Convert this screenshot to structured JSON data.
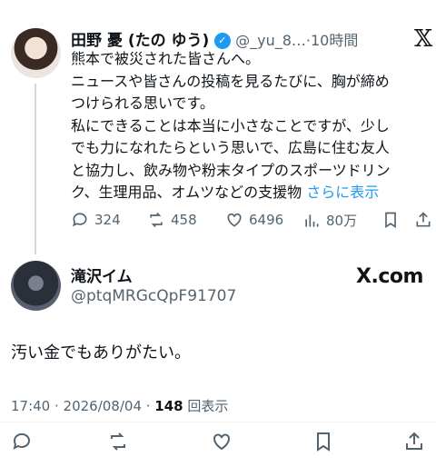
{
  "tweet1": {
    "display_name": "田野 憂 (たの ゆう)",
    "handle": "@_yu_8…",
    "time": "10時間",
    "lines": [
      "熊本で被災された皆さんへ。",
      "ニュースや皆さんの投稿を見るたびに、胸が締め",
      "つけられる思いです。",
      "私にできることは本当に小さなことですが、少し",
      "でも力になれたらという思いで、広島に住む友人",
      "と協力し、飲み物や粉末タイプのスポーツドリン"
    ],
    "last_line": "ク、生理用品、オムツなどの支援物",
    "show_more": "さらに表示",
    "stats": {
      "replies": "324",
      "reposts": "458",
      "likes": "6496",
      "views": "80万"
    }
  },
  "tweet2": {
    "display_name": "滝沢イム",
    "handle": "@ptqMRGcQpF91707",
    "watermark": "X.com",
    "body": "汚い金でもありがたい。",
    "timestamp": "17:40 · 2026/08/04 · ",
    "view_count": "148",
    "view_label": " 回表示"
  },
  "icons": {
    "reply": "reply-icon",
    "repost": "repost-icon",
    "like": "heart-icon",
    "views": "views-icon",
    "bookmark": "bookmark-icon",
    "share": "share-icon",
    "verified": "verified-badge-icon",
    "x_logo": "x-logo-icon"
  },
  "colors": {
    "accent": "#1d9bf0",
    "text": "#0f1419",
    "muted": "#536471"
  }
}
